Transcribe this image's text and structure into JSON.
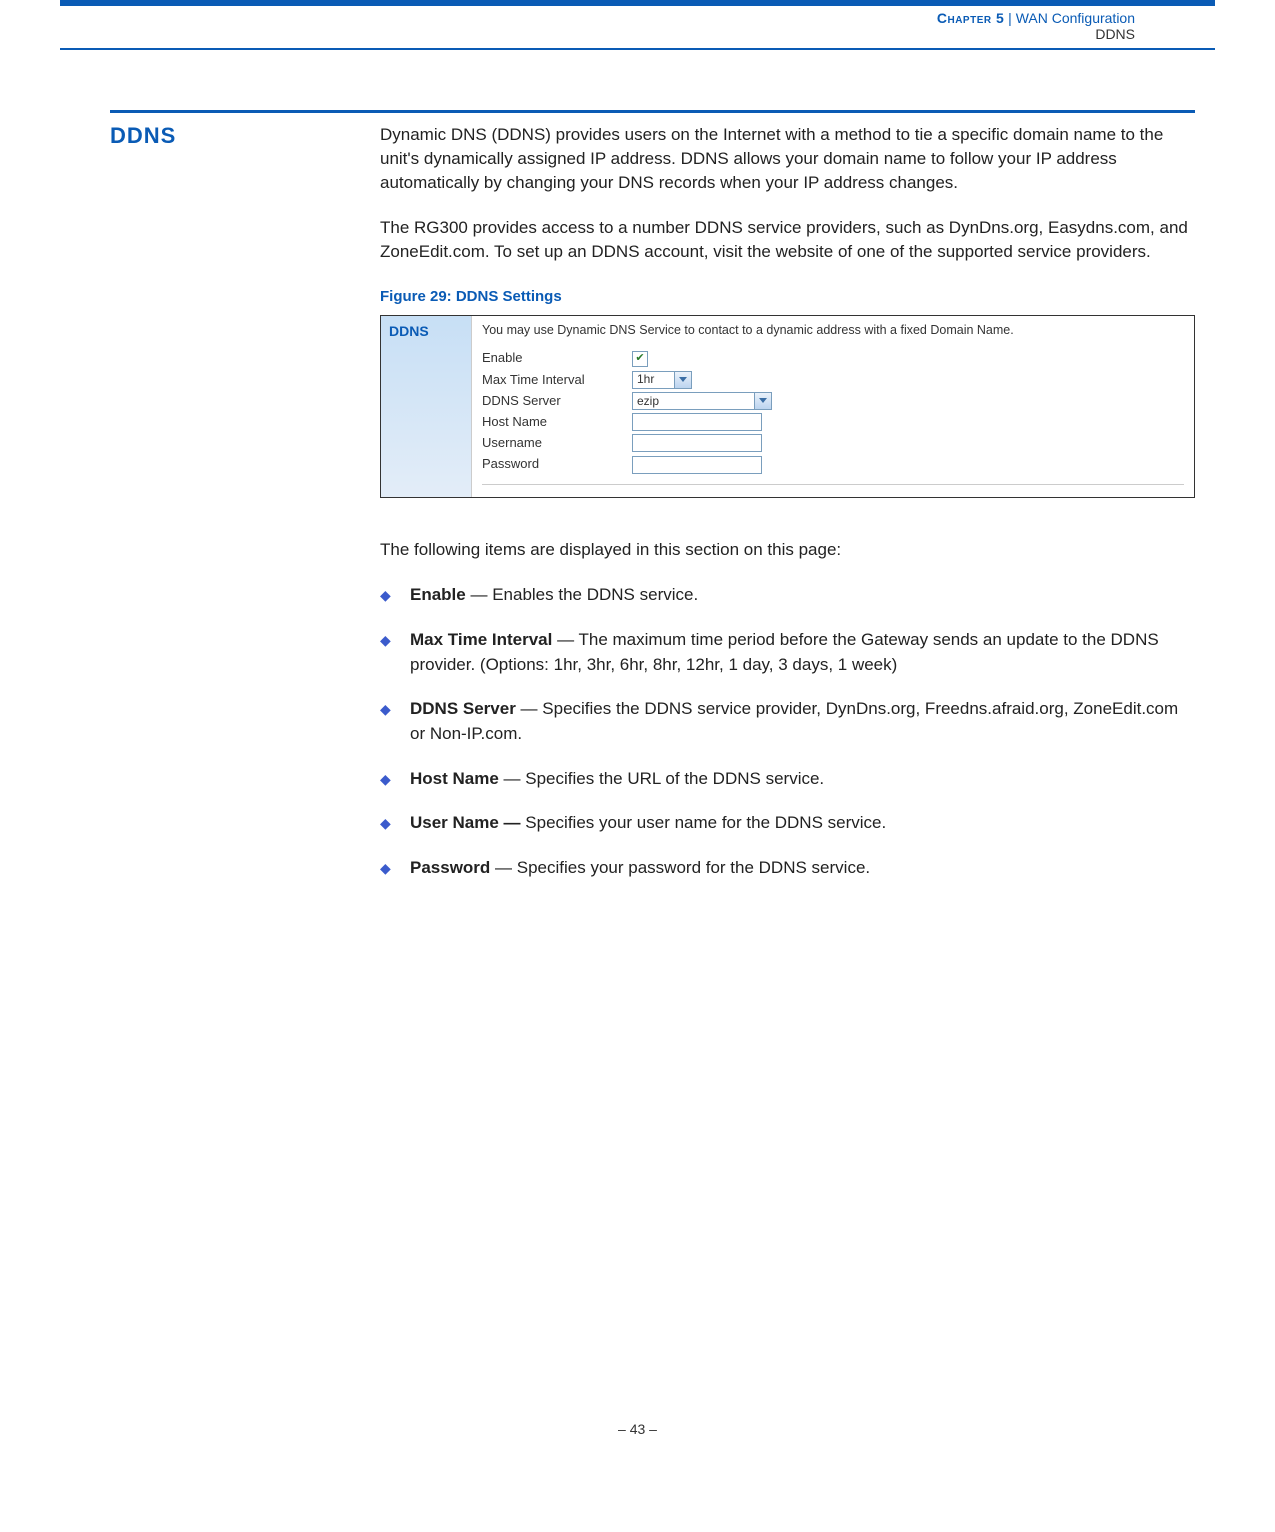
{
  "header": {
    "chapter_strong": "Chapter 5",
    "chapter_sep": "  |  ",
    "chapter_rest": "WAN Configuration",
    "sub": "DDNS"
  },
  "section": {
    "title": "DDNS",
    "para1": "Dynamic DNS (DDNS) provides users on the Internet with a method to tie a specific domain name to the unit's dynamically assigned IP address. DDNS allows your domain name to follow your IP address automatically by changing your DNS records when your IP address changes.",
    "para2": "The RG300 provides access to a number DDNS service providers, such as DynDns.org, Easydns.com, and ZoneEdit.com. To set up an DDNS account, visit the website of one of the supported service providers.",
    "figure_caption": "Figure 29:  DDNS Settings",
    "following_intro": "The following items are displayed in this section on this page:"
  },
  "figure": {
    "sidebar_title": "DDNS",
    "note": "You may use Dynamic DNS Service to contact to a dynamic address with a fixed Domain Name.",
    "rows": {
      "enable": "Enable",
      "max_time": "Max Time Interval",
      "max_time_val": "1hr",
      "ddns_server": "DDNS Server",
      "ddns_server_val": "ezip",
      "host_name": "Host Name",
      "username": "Username",
      "password": "Password"
    }
  },
  "items": [
    {
      "label": "Enable",
      "dash": " — ",
      "desc": "Enables the DDNS service."
    },
    {
      "label": "Max Time Interval",
      "dash": " — ",
      "desc": "The maximum time period before the Gateway sends an update to the DDNS provider. (Options: 1hr, 3hr, 6hr, 8hr, 12hr, 1 day, 3 days, 1 week)"
    },
    {
      "label": "DDNS Server",
      "dash": " — ",
      "desc": "Specifies the DDNS service provider, DynDns.org, Freedns.afraid.org, ZoneEdit.com or Non-IP.com."
    },
    {
      "label": "Host Name",
      "dash": " — ",
      "desc": "Specifies the URL of the DDNS service."
    },
    {
      "label": "User Name —",
      "dash": " ",
      "desc": "Specifies your user name for the DDNS service."
    },
    {
      "label": "Password",
      "dash": " — ",
      "desc": "Specifies your password for the DDNS service."
    }
  ],
  "footer": "–  43  –"
}
